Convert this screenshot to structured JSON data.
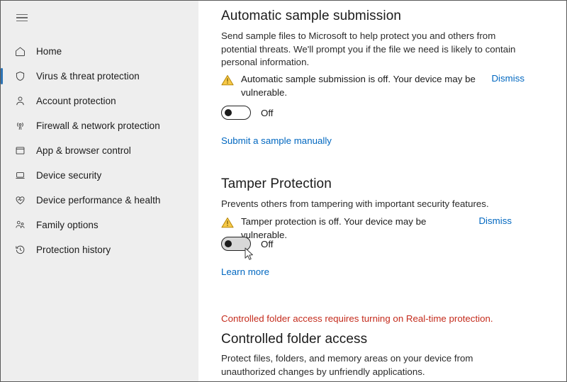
{
  "window": {
    "border_color": "#5a5a5a",
    "sidebar_bg": "#eeeeee",
    "accent_color": "#2e74b5",
    "link_color": "#0067c0",
    "error_color": "#c42b1c",
    "warning_color": "#f7b500"
  },
  "sidebar": {
    "menu_button": "hamburger-menu",
    "items": [
      {
        "label": "Home",
        "icon": "home-icon",
        "selected": false
      },
      {
        "label": "Virus & threat protection",
        "icon": "shield-icon",
        "selected": true
      },
      {
        "label": "Account protection",
        "icon": "person-icon",
        "selected": false
      },
      {
        "label": "Firewall & network protection",
        "icon": "broadcast-icon",
        "selected": false
      },
      {
        "label": "App & browser control",
        "icon": "app-window-icon",
        "selected": false
      },
      {
        "label": "Device security",
        "icon": "laptop-icon",
        "selected": false
      },
      {
        "label": "Device performance & health",
        "icon": "heart-pulse-icon",
        "selected": false
      },
      {
        "label": "Family options",
        "icon": "family-icon",
        "selected": false
      },
      {
        "label": "Protection history",
        "icon": "history-clock-icon",
        "selected": false
      }
    ]
  },
  "main": {
    "automatic_sample_submission": {
      "title": "Automatic sample submission",
      "description": "Send sample files to Microsoft to help protect you and others from potential threats. We'll prompt you if the file we need is likely to contain personal information.",
      "warning": {
        "icon": "warning-triangle-icon",
        "text": "Automatic sample submission is off. Your device may be vulnerable.",
        "dismiss_label": "Dismiss"
      },
      "toggle": {
        "state": "Off",
        "checked": false,
        "hovered": false
      },
      "link": "Submit a sample manually"
    },
    "tamper_protection": {
      "title": "Tamper Protection",
      "description": "Prevents others from tampering with important security features.",
      "warning": {
        "icon": "warning-triangle-icon",
        "text": "Tamper protection is off. Your device may be vulnerable.",
        "dismiss_label": "Dismiss"
      },
      "toggle": {
        "state": "Off",
        "checked": false,
        "hovered": true
      },
      "link": "Learn more"
    },
    "controlled_folder_access": {
      "error": "Controlled folder access requires turning on Real-time protection.",
      "title": "Controlled folder access",
      "description": "Protect files, folders, and memory areas on your device from unauthorized changes by unfriendly applications."
    }
  }
}
